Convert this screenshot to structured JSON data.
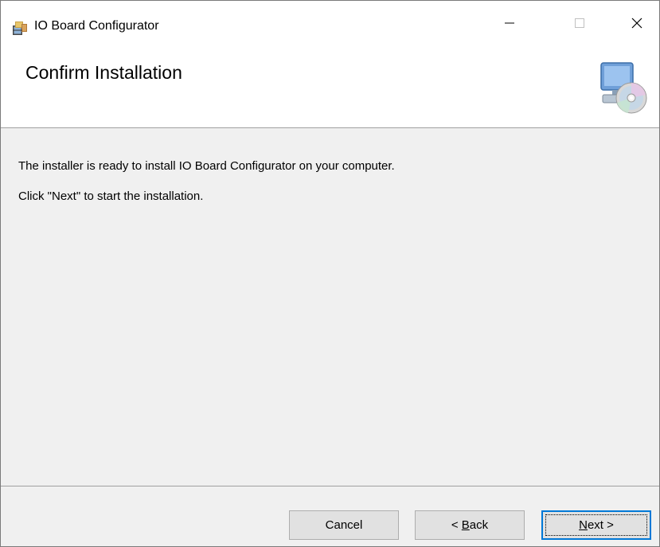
{
  "window": {
    "title": "IO Board Configurator",
    "controls": {
      "minimize": "—",
      "maximize": "☐",
      "close": "✕"
    }
  },
  "banner": {
    "title": "Confirm Installation",
    "graphic": "computer-with-disc-icon"
  },
  "content": {
    "message": "The installer is ready to install IO Board Configurator on your computer.",
    "instruction": "Click \"Next\" to start the installation."
  },
  "buttons": {
    "cancel": "Cancel",
    "back_prefix": "< ",
    "back_accel": "B",
    "back_rest": "ack",
    "next_accel": "N",
    "next_rest": "ext >"
  },
  "colors": {
    "accent_focus": "#0078d7",
    "dialog_bg": "#f0f0f0",
    "button_bg": "#e1e1e1"
  }
}
